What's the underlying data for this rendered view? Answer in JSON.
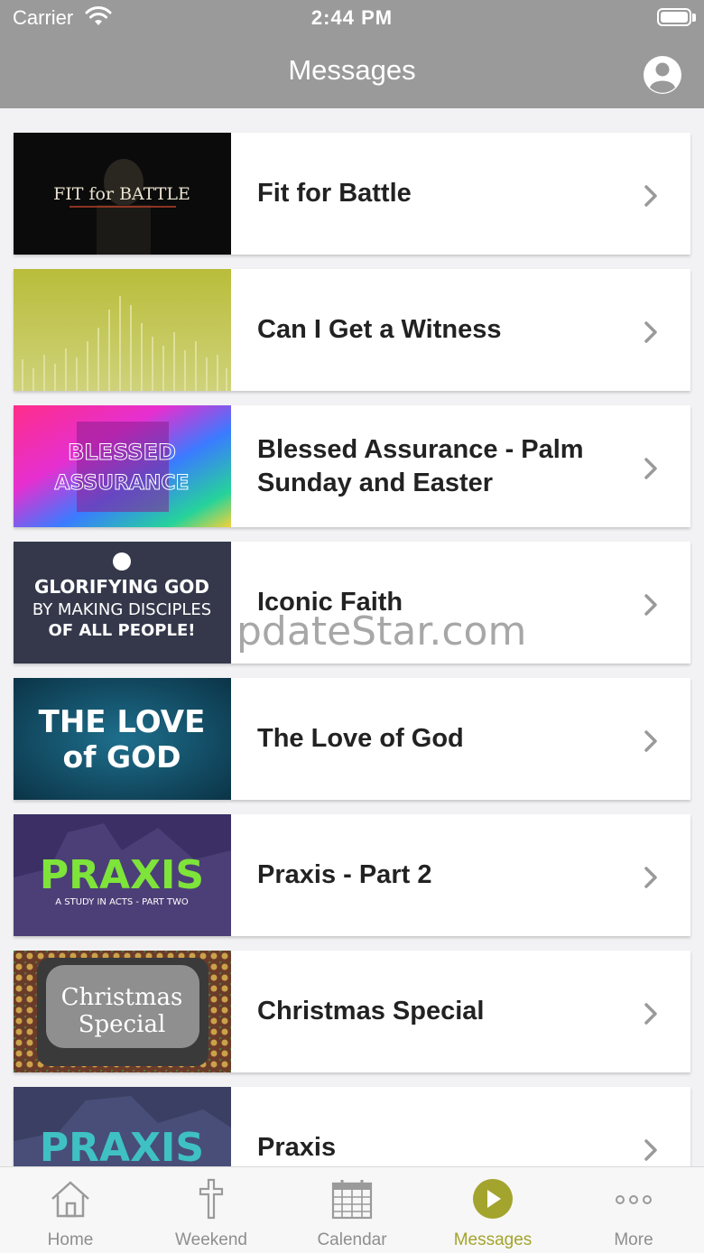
{
  "status_bar": {
    "carrier": "Carrier",
    "time": "2:44 PM"
  },
  "nav": {
    "title": "Messages"
  },
  "messages": [
    {
      "title": "Fit for Battle",
      "thumb_text": "FIT for BATTLE"
    },
    {
      "title": "Can I Get a Witness"
    },
    {
      "title": "Blessed Assurance - Palm Sunday and Easter",
      "thumb_text": "BLESSED ASSURANCE"
    },
    {
      "title": "Iconic Faith",
      "thumb_text": "GLORIFYING GOD BY MAKING DISCIPLES OF ALL PEOPLE!"
    },
    {
      "title": "The Love of God",
      "thumb_text": "THE LOVE of GOD"
    },
    {
      "title": "Praxis - Part 2",
      "thumb_text": "PRAXIS"
    },
    {
      "title": "Christmas Special",
      "thumb_text": "Christmas Special"
    },
    {
      "title": "Praxis",
      "thumb_text": "PRAXIS"
    }
  ],
  "watermark": "pdateStar.com",
  "tabs": [
    {
      "label": "Home",
      "icon": "home-icon"
    },
    {
      "label": "Weekend",
      "icon": "cross-icon"
    },
    {
      "label": "Calendar",
      "icon": "calendar-icon"
    },
    {
      "label": "Messages",
      "icon": "play-icon",
      "active": true
    },
    {
      "label": "More",
      "icon": "more-icon"
    }
  ],
  "colors": {
    "nav_bg": "#9a9a9a",
    "accent": "#a3a42d"
  }
}
